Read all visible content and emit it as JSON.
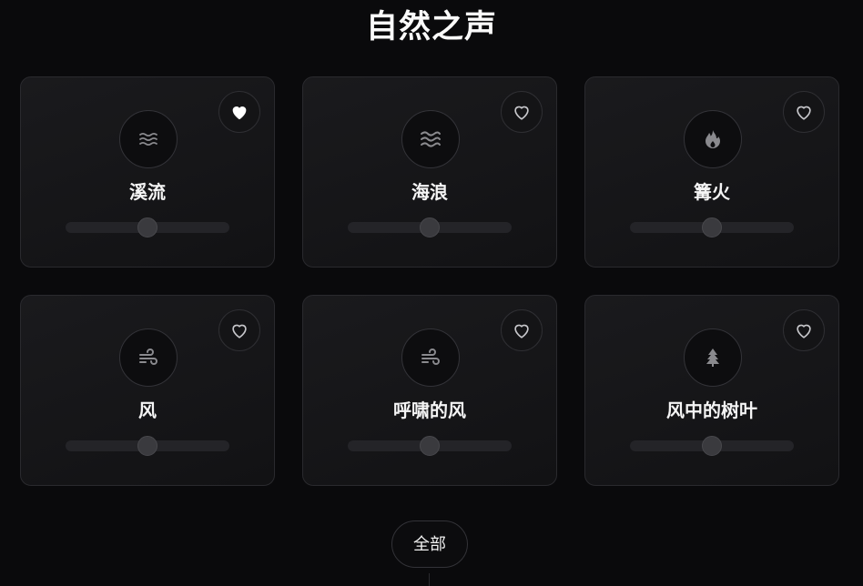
{
  "page": {
    "title": "自然之声"
  },
  "sounds": [
    {
      "name": "溪流",
      "icon": "water-icon",
      "favorited": true,
      "volume": 0.5
    },
    {
      "name": "海浪",
      "icon": "waves-icon",
      "favorited": false,
      "volume": 0.5
    },
    {
      "name": "篝火",
      "icon": "flame-icon",
      "favorited": false,
      "volume": 0.5
    },
    {
      "name": "风",
      "icon": "wind-icon",
      "favorited": false,
      "volume": 0.5
    },
    {
      "name": "呼啸的风",
      "icon": "wind-icon",
      "favorited": false,
      "volume": 0.5
    },
    {
      "name": "风中的树叶",
      "icon": "tree-icon",
      "favorited": false,
      "volume": 0.5
    }
  ],
  "footer": {
    "all_label": "全部"
  },
  "colors": {
    "background": "#0a0a0c",
    "icon_gray": "#8a8a8e",
    "heart_active": "#ffffff"
  }
}
